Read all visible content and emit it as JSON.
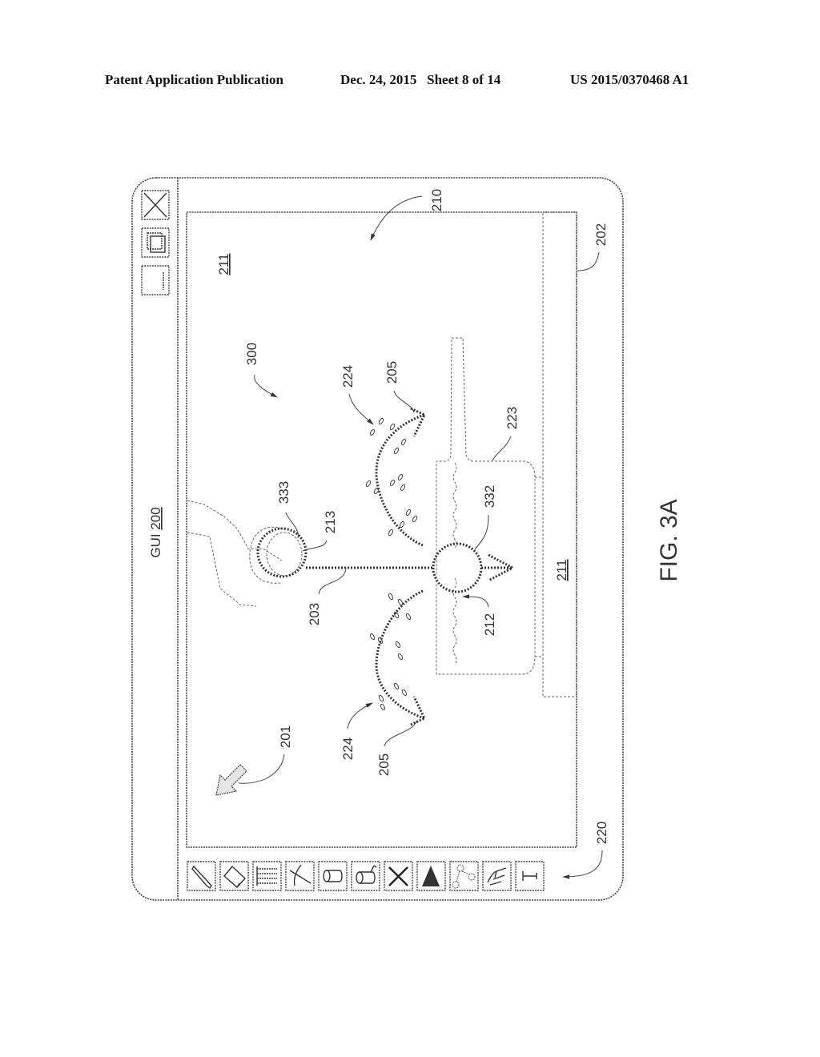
{
  "header": {
    "left": "Patent Application Publication",
    "middle": "Dec. 24, 2015   Sheet 8 of 14",
    "right": "US 2015/0370468 A1"
  },
  "figure": {
    "title": "FIG. 3A",
    "orientation": "rotated 90 degrees counter-clockwise (landscape GUI drawn on portrait sheet)",
    "window": {
      "title_prefix": "GUI ",
      "title_ref": "200",
      "controls": [
        "close-icon",
        "restore-icon",
        "minimize-icon"
      ]
    },
    "toolbar": {
      "ref": "220",
      "tools": [
        {
          "name": "pencil-tool",
          "icon": "pencil-icon"
        },
        {
          "name": "eraser-tool",
          "icon": "eraser-icon"
        },
        {
          "name": "flow-lines-tool",
          "icon": "flow-lines-icon"
        },
        {
          "name": "cut-line-tool",
          "icon": "cut-line-icon"
        },
        {
          "name": "cylinder-tool",
          "icon": "cylinder-icon"
        },
        {
          "name": "cylinder-spout-tool",
          "icon": "cylinder-spout-icon"
        },
        {
          "name": "delete-tool",
          "icon": "x-icon"
        },
        {
          "name": "cone-tool",
          "icon": "triangle-icon"
        },
        {
          "name": "node-graph-tool",
          "icon": "node-graph-icon"
        },
        {
          "name": "hand-gesture-tool",
          "icon": "hand-icon"
        },
        {
          "name": "text-tool",
          "icon": "text-icon"
        }
      ]
    },
    "reference_labels": {
      "canvas": "210",
      "panel": "202",
      "background_top": "211",
      "background_bottom": "211",
      "gesture": "300",
      "splash_top_drops": "224",
      "splash_top_curve": "205",
      "container": "223",
      "touch_point": "333",
      "touch_circle": "213",
      "drag_line": "203",
      "target_circle": "332",
      "liquid_surface": "212",
      "splash_bottom_drops": "224",
      "splash_bottom_curve": "205",
      "cursor": "201"
    }
  }
}
